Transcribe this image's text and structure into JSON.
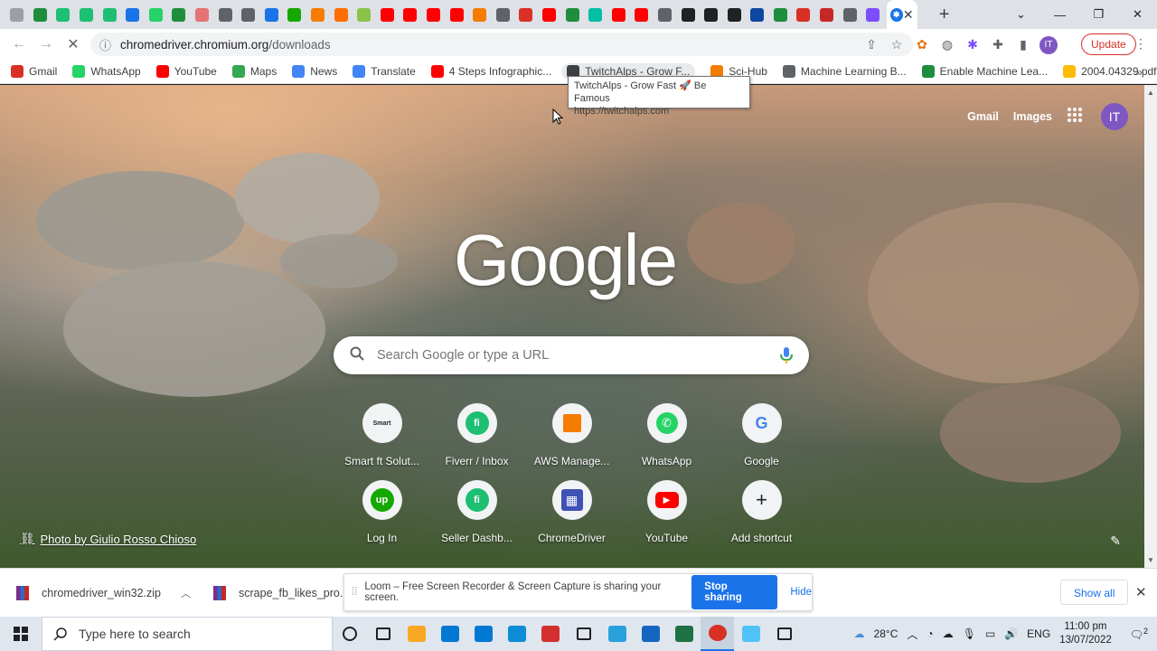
{
  "browser": {
    "tab_favicons": [
      {
        "icon": "twitchalps-icon",
        "color": "#9aa0a6"
      },
      {
        "icon": "plus-green-icon",
        "color": "#1e8e3e"
      },
      {
        "icon": "fiverr-icon",
        "color": "#1dbf73"
      },
      {
        "icon": "fiverr-icon",
        "color": "#1dbf73"
      },
      {
        "icon": "fiverr-icon",
        "color": "#1dbf73"
      },
      {
        "icon": "refresh-blue-icon",
        "color": "#1a73e8"
      },
      {
        "icon": "whatsapp-icon",
        "color": "#25d366"
      },
      {
        "icon": "plus-green-icon",
        "color": "#1e8e3e"
      },
      {
        "icon": "shield-icon",
        "color": "#e57373"
      },
      {
        "icon": "dash-icon",
        "color": "#5f6368"
      },
      {
        "icon": "chromium-icon",
        "color": "#5f6368"
      },
      {
        "icon": "refresh-blue-icon",
        "color": "#1a73e8"
      },
      {
        "icon": "upwork-icon",
        "color": "#14a800"
      },
      {
        "icon": "aws-box-icon",
        "color": "#f57c00"
      },
      {
        "icon": "arrow-icon",
        "color": "#ff6d00"
      },
      {
        "icon": "swirl-icon",
        "color": "#8bc34a"
      },
      {
        "icon": "youtube-icon",
        "color": "#ff0000"
      },
      {
        "icon": "youtube-icon",
        "color": "#ff0000"
      },
      {
        "icon": "youtube-icon",
        "color": "#ff0000"
      },
      {
        "icon": "youtube-icon",
        "color": "#ff0000"
      },
      {
        "icon": "orange-square-icon",
        "color": "#f57c00"
      },
      {
        "icon": "chromium-icon",
        "color": "#5f6368"
      },
      {
        "icon": "red-x-icon",
        "color": "#d93025"
      },
      {
        "icon": "youtube-icon",
        "color": "#ff0000"
      },
      {
        "icon": "plus-green-icon",
        "color": "#1e8e3e"
      },
      {
        "icon": "teal-icon",
        "color": "#00bfa5"
      },
      {
        "icon": "youtube-icon",
        "color": "#ff0000"
      },
      {
        "icon": "youtube-icon",
        "color": "#ff0000"
      },
      {
        "icon": "chromium-icon",
        "color": "#5f6368"
      },
      {
        "icon": "github-icon",
        "color": "#202124"
      },
      {
        "icon": "github-icon",
        "color": "#202124"
      },
      {
        "icon": "github-icon",
        "color": "#202124"
      },
      {
        "icon": "b-blue-icon",
        "color": "#0d47a1"
      },
      {
        "icon": "plus-green-icon",
        "color": "#1e8e3e"
      },
      {
        "icon": "gmail-icon",
        "color": "#d93025"
      },
      {
        "icon": "record-icon",
        "color": "#c62828"
      },
      {
        "icon": "chromium-icon",
        "color": "#5f6368"
      },
      {
        "icon": "gear-purple-icon",
        "color": "#7c4dff"
      }
    ],
    "active_tab_icon": "gear-icon",
    "omnibox": {
      "domain": "chromedriver.chromium.org",
      "path": "/downloads"
    },
    "update_label": "Update",
    "profile_initials": "IT"
  },
  "bookmarks": [
    {
      "label": "Gmail",
      "icon": "gmail-icon",
      "color": "#d93025"
    },
    {
      "label": "WhatsApp",
      "icon": "whatsapp-icon",
      "color": "#25d366"
    },
    {
      "label": "YouTube",
      "icon": "youtube-icon",
      "color": "#ff0000"
    },
    {
      "label": "Maps",
      "icon": "maps-icon",
      "color": "#34a853"
    },
    {
      "label": "News",
      "icon": "news-icon",
      "color": "#4285f4"
    },
    {
      "label": "Translate",
      "icon": "translate-icon",
      "color": "#4285f4"
    },
    {
      "label": "4 Steps Infographic...",
      "icon": "youtube-icon",
      "color": "#ff0000"
    },
    {
      "label": "TwitchAlps - Grow F...",
      "icon": "twitchalps-icon",
      "color": "#3c4043"
    },
    {
      "label": "Sci-Hub",
      "icon": "scihub-icon",
      "color": "#f57c00"
    },
    {
      "label": "Machine Learning B...",
      "icon": "ml-icon",
      "color": "#5f6368"
    },
    {
      "label": "Enable Machine Lea...",
      "icon": "doc-icon",
      "color": "#1e8e3e"
    },
    {
      "label": "2004.04329.pdf",
      "icon": "pdf-icon",
      "color": "#fbbc04"
    }
  ],
  "tooltip": {
    "title": "TwitchAlps - Grow Fast 🚀 Be Famous",
    "url": "https://twitchalps.com"
  },
  "newtab": {
    "links": {
      "gmail": "Gmail",
      "images": "Images"
    },
    "avatar": "IT",
    "logo": "Google",
    "search_placeholder": "Search Google or type a URL",
    "shortcuts": [
      {
        "label": "Smart ft Solut...",
        "icon": "smartft-icon",
        "color": "#202124",
        "glyph": "Smart"
      },
      {
        "label": "Fiverr / Inbox",
        "icon": "fiverr-icon",
        "color": "#1dbf73",
        "glyph": "fi"
      },
      {
        "label": "AWS Manage...",
        "icon": "aws-box-icon",
        "color": "#f57c00",
        "glyph": ""
      },
      {
        "label": "WhatsApp",
        "icon": "whatsapp-icon",
        "color": "#25d366",
        "glyph": "✆"
      },
      {
        "label": "Google",
        "icon": "google-g-icon",
        "color": "#4285f4",
        "glyph": "G"
      },
      {
        "label": "Log In",
        "icon": "upwork-icon",
        "color": "#14a800",
        "glyph": "up"
      },
      {
        "label": "Seller Dashb...",
        "icon": "fiverr-icon",
        "color": "#1dbf73",
        "glyph": "fi"
      },
      {
        "label": "ChromeDriver",
        "icon": "chromedriver-icon",
        "color": "#3f51b5",
        "glyph": "▦"
      },
      {
        "label": "YouTube",
        "icon": "youtube-icon",
        "color": "#ff0000",
        "glyph": "▶"
      },
      {
        "label": "Add shortcut",
        "icon": "plus-icon",
        "color": "#202124",
        "glyph": "+"
      }
    ],
    "photo_credit": "Photo by Giulio Rosso Chioso"
  },
  "downloads": {
    "items": [
      {
        "name": "chromedriver_win32.zip"
      },
      {
        "name": "scrape_fb_likes_pro...."
      }
    ],
    "loom_message": "Loom – Free Screen Recorder & Screen Capture is sharing your screen.",
    "stop_label": "Stop sharing",
    "hide_label": "Hide",
    "show_all": "Show all"
  },
  "taskbar": {
    "search_placeholder": "Type here to search",
    "apps": [
      {
        "icon": "cortana-icon",
        "color": "#202124"
      },
      {
        "icon": "task-view-icon",
        "color": "#202124"
      },
      {
        "icon": "file-explorer-icon",
        "color": "#f9a825"
      },
      {
        "icon": "store-icon",
        "color": "#0078d4"
      },
      {
        "icon": "mail-icon",
        "color": "#0078d4"
      },
      {
        "icon": "edge-icon",
        "color": "#0c8dd6"
      },
      {
        "icon": "screen-recorder-icon",
        "color": "#d32f2f"
      },
      {
        "icon": "settings-icon",
        "color": "#202124"
      },
      {
        "icon": "telegram-icon",
        "color": "#29a0dc"
      },
      {
        "icon": "remote-desktop-icon",
        "color": "#1565c0"
      },
      {
        "icon": "excel-icon",
        "color": "#1e7145"
      },
      {
        "icon": "chrome-icon",
        "color": "#d93025"
      },
      {
        "icon": "notes-icon",
        "color": "#4fc3f7"
      },
      {
        "icon": "terminal-icon",
        "color": "#202124"
      }
    ],
    "weather": "28°C",
    "lang": "ENG",
    "time": "11:00 pm",
    "date": "13/07/2022",
    "notifications": "2"
  }
}
